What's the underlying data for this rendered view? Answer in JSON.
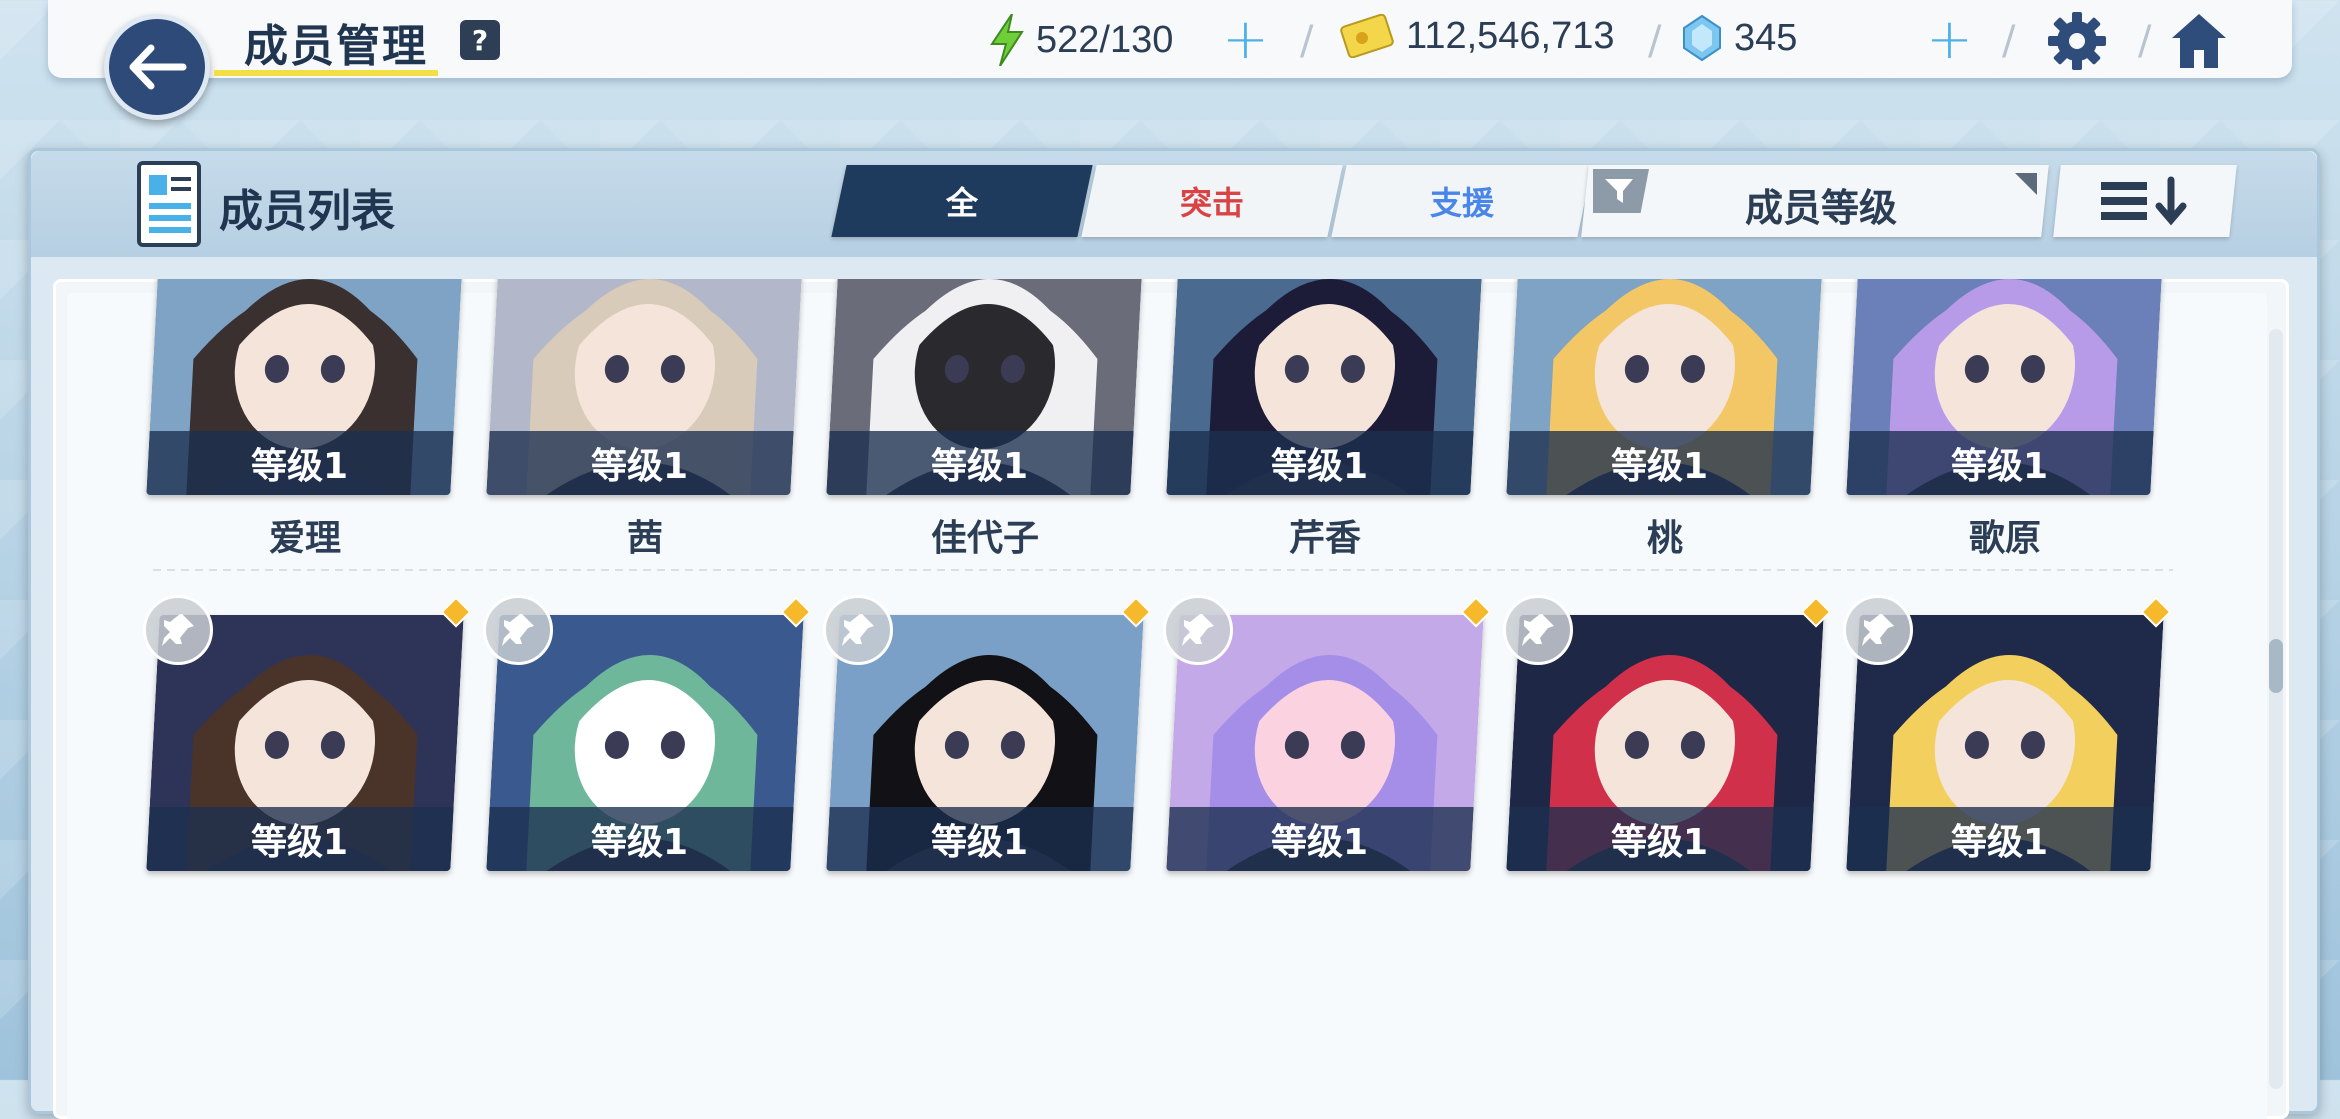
{
  "header": {
    "title": "成员管理",
    "help": "?",
    "ap": "522/130",
    "credits": "112,546,713",
    "gems": "345"
  },
  "panel": {
    "title": "成员列表",
    "tabs": [
      {
        "label": "全",
        "color": "#ffffff"
      },
      {
        "label": "突击",
        "color": "#d94343"
      },
      {
        "label": "支援",
        "color": "#4a86e8"
      }
    ],
    "filter_label": "成员等级"
  },
  "members_row1": [
    {
      "level": "等级1",
      "name": "爱理",
      "palette": [
        "#7fa3c4",
        "#3a3030",
        "#f4e4da"
      ]
    },
    {
      "level": "等级1",
      "name": "茜",
      "palette": [
        "#b2b7c9",
        "#d8cbb9",
        "#f4e4da"
      ]
    },
    {
      "level": "等级1",
      "name": "佳代子",
      "palette": [
        "#6a6c7a",
        "#f0f0f2",
        "#2a2a2e"
      ]
    },
    {
      "level": "等级1",
      "name": "芹香",
      "palette": [
        "#4b6a8f",
        "#1c1c38",
        "#f4e4da"
      ]
    },
    {
      "level": "等级1",
      "name": "桃",
      "palette": [
        "#7fa3c4",
        "#f3c766",
        "#f4e4da"
      ]
    },
    {
      "level": "等级1",
      "name": "歌原",
      "palette": [
        "#6b7fb8",
        "#b79be8",
        "#f4e4da"
      ]
    }
  ],
  "members_row2": [
    {
      "level": "等级1",
      "palette": [
        "#2e3457",
        "#4a3328",
        "#f4e4da"
      ]
    },
    {
      "level": "等级1",
      "palette": [
        "#3a5a8f",
        "#6fb79b",
        "#ffffff"
      ]
    },
    {
      "level": "等级1",
      "palette": [
        "#7aa0c8",
        "#111116",
        "#f4e4da"
      ]
    },
    {
      "level": "等级1",
      "palette": [
        "#c4a9e8",
        "#a58ee8",
        "#fbd3e0"
      ]
    },
    {
      "level": "等级1",
      "palette": [
        "#1e2746",
        "#d0304a",
        "#f4e4da"
      ]
    },
    {
      "level": "等级1",
      "palette": [
        "#1f2a4a",
        "#f3cf5e",
        "#f4e4da"
      ]
    }
  ]
}
